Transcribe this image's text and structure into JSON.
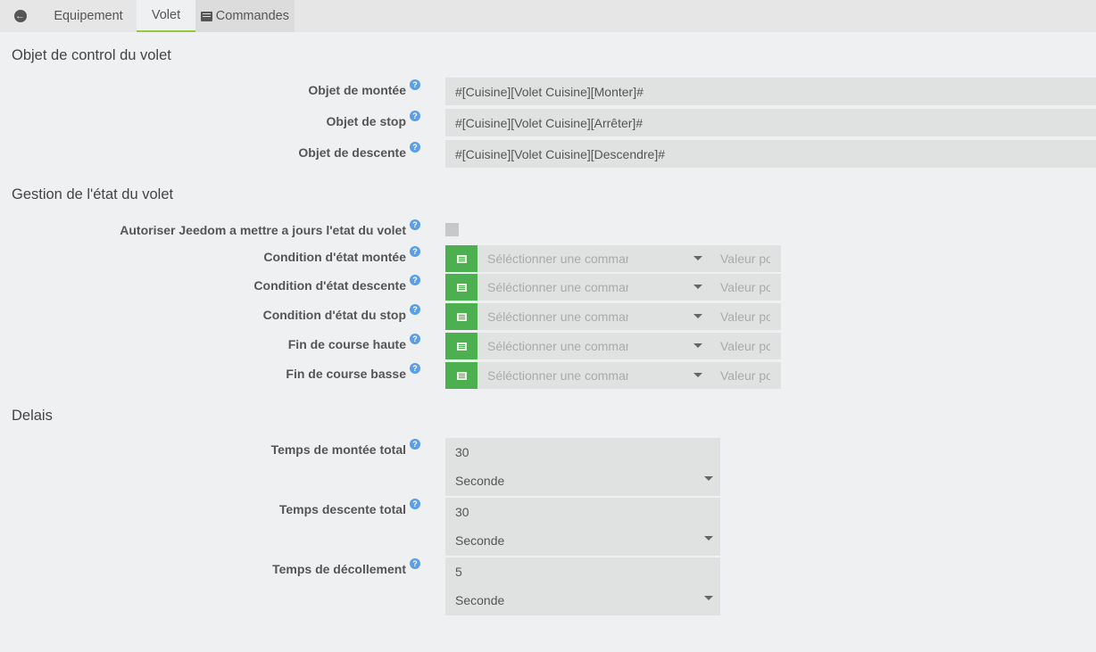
{
  "tabs": {
    "equipement": "Equipement",
    "volet": "Volet",
    "commandes": "Commandes"
  },
  "sections": {
    "control": "Objet de control du volet",
    "etat": "Gestion de l'état du volet",
    "delais": "Delais"
  },
  "control": [
    {
      "label": "Objet de montée",
      "value": "#[Cuisine][Volet Cuisine][Monter]#"
    },
    {
      "label": "Objet de stop",
      "value": "#[Cuisine][Volet Cuisine][Arrêter]#"
    },
    {
      "label": "Objet de descente",
      "value": "#[Cuisine][Volet Cuisine][Descendre]#"
    }
  ],
  "help": "?",
  "etat": {
    "autoriser": "Autoriser Jeedom a mettre a jours l'etat du volet",
    "select_placeholder": "Séléctionner une commande",
    "value_placeholder": "Valeur pour",
    "conditions": [
      "Condition d'état montée",
      "Condition d'état descente",
      "Condition d'état du stop",
      "Fin de course haute",
      "Fin de course basse"
    ]
  },
  "delais": [
    {
      "label": "Temps de montée total",
      "value": "30",
      "unit": "Seconde"
    },
    {
      "label": "Temps descente total",
      "value": "30",
      "unit": "Seconde"
    },
    {
      "label": "Temps de décollement",
      "value": "5",
      "unit": "Seconde"
    }
  ]
}
